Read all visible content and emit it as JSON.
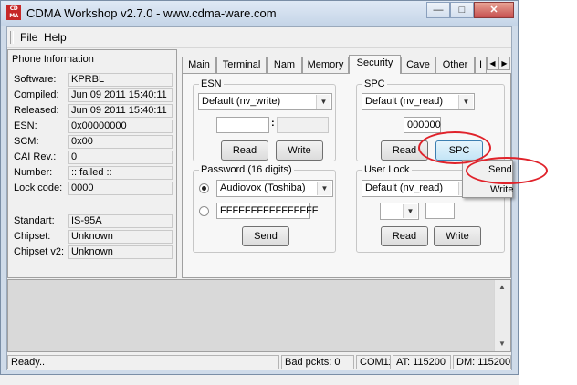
{
  "window": {
    "title": "CDMA Workshop v2.7.0  -  www.cdma-ware.com",
    "icon_label": "CDMA"
  },
  "caption_buttons": {
    "minimize": "—",
    "maximize": "□",
    "close": "✕"
  },
  "menu": {
    "items": [
      "File",
      "Help"
    ]
  },
  "phone_info": {
    "title": "Phone Information",
    "rows": [
      {
        "label": "Software:",
        "value": "KPRBL"
      },
      {
        "label": "Compiled:",
        "value": "Jun 09 2011 15:40:11"
      },
      {
        "label": "Released:",
        "value": "Jun 09 2011 15:40:11"
      },
      {
        "label": "ESN:",
        "value": "0x00000000"
      },
      {
        "label": "SCM:",
        "value": "0x00"
      },
      {
        "label": "CAI Rev.:",
        "value": "0"
      },
      {
        "label": "Number:",
        "value": ":: failed ::"
      },
      {
        "label": "Lock code:",
        "value": "0000"
      },
      {
        "label": "Standart:",
        "value": "IS-95A"
      },
      {
        "label": "Chipset:",
        "value": "Unknown"
      },
      {
        "label": "Chipset v2:",
        "value": "Unknown"
      }
    ]
  },
  "tabs": {
    "items": [
      "Main",
      "Terminal",
      "Nam",
      "Memory",
      "Security",
      "Cave",
      "Other",
      "I"
    ],
    "active": "Security",
    "arrow_left": "◀",
    "arrow_right": "▶"
  },
  "security": {
    "esn": {
      "title": "ESN",
      "mode": "Default (nv_write)",
      "field1": "",
      "field2": "",
      "separator": ":",
      "read": "Read",
      "write": "Write"
    },
    "spc": {
      "title": "SPC",
      "mode": "Default (nv_read)",
      "code": "000000",
      "read": "Read",
      "spc_button": "SPC"
    },
    "password": {
      "title": "Password (16 digits)",
      "option1": "Audiovox (Toshiba)",
      "option2_value": "FFFFFFFFFFFFFFFF",
      "send": "Send",
      "selected": "option1"
    },
    "user_lock": {
      "title": "User Lock",
      "mode": "Default (nv_read)",
      "combo_value": "",
      "field": "",
      "read": "Read",
      "write": "Write"
    }
  },
  "context_menu": {
    "items": [
      "Send",
      "Write"
    ]
  },
  "statusbar": {
    "status": "Ready..",
    "bad_packets": "Bad pckts: 0",
    "port": "COM11",
    "at": "AT: 115200",
    "dm": "DM: 115200"
  },
  "icons": {
    "dropdown": "▼",
    "scroll_up": "▲",
    "scroll_down": "▼"
  },
  "colors": {
    "annotation": "#e0222a",
    "title_bar": "#cfdbe9"
  }
}
